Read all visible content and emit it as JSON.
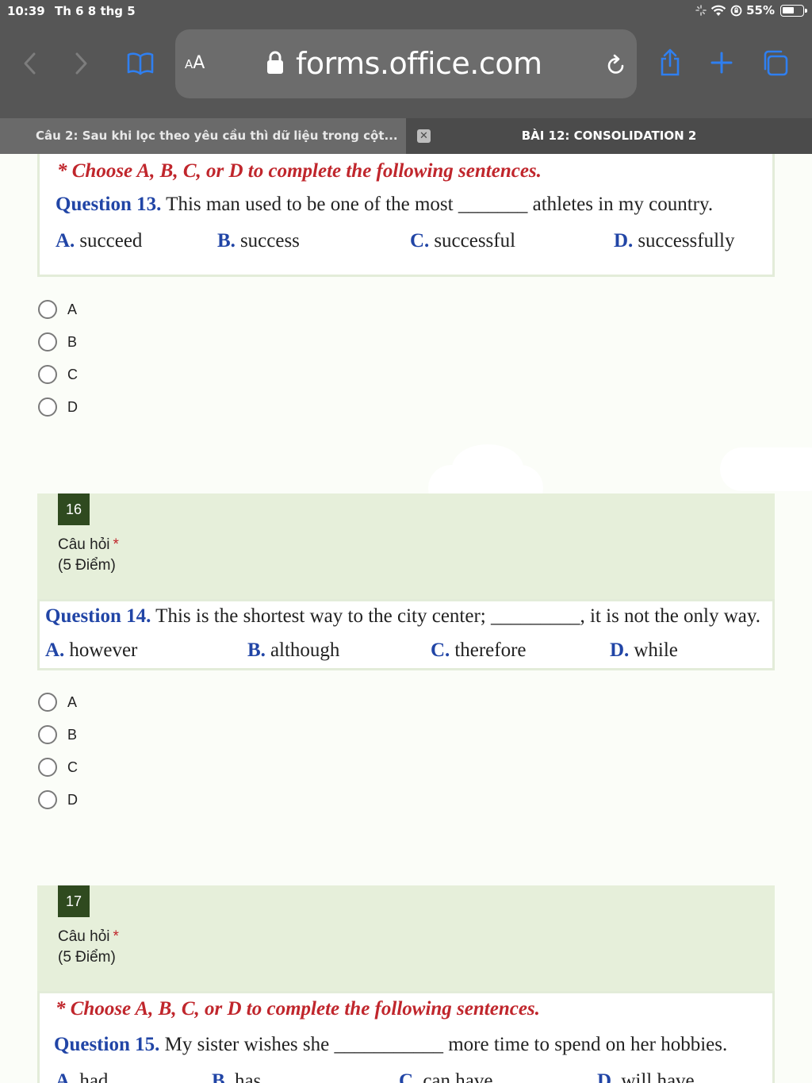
{
  "status_bar": {
    "time": "10:39",
    "date": "Th 6 8 thg 5",
    "battery": "55%"
  },
  "browser": {
    "url_aa": "AA",
    "domain": "forms.office.com",
    "tabs": [
      {
        "label": "Câu 2: Sau khi lọc theo yêu cầu thì dữ liệu trong cột...",
        "active": true
      },
      {
        "label": "BÀI 12: CONSOLIDATION 2",
        "active": false
      }
    ],
    "accent": "#2f7ff0"
  },
  "form": {
    "instruction": "* Choose A, B, C, or D to complete the following sentences.",
    "question_label": "Câu hỏi",
    "required_mark": "*",
    "q13": {
      "number_label": "Question 13.",
      "text": "This man used to be one of the most _______ athletes in my country.",
      "options": [
        {
          "letter": "A.",
          "text": "succeed"
        },
        {
          "letter": "B.",
          "text": "success"
        },
        {
          "letter": "C.",
          "text": "successful"
        },
        {
          "letter": "D.",
          "text": "successfully"
        }
      ],
      "choices": [
        "A",
        "B",
        "C",
        "D"
      ]
    },
    "q16": {
      "badge": "16",
      "points": "(5 Điểm)",
      "number_label": "Question 14.",
      "text": "This  is the shortest way to the city center; _________, it is not the only way.",
      "options": [
        {
          "letter": "A.",
          "text": "however"
        },
        {
          "letter": "B.",
          "text": "although"
        },
        {
          "letter": "C.",
          "text": "therefore"
        },
        {
          "letter": "D.",
          "text": "while"
        }
      ],
      "choices": [
        "A",
        "B",
        "C",
        "D"
      ]
    },
    "q17": {
      "badge": "17",
      "points": "(5 Điểm)",
      "number_label": "Question 15.",
      "text": "My sister wishes  she ___________ more time to spend on her hobbies.",
      "options": [
        {
          "letter": "A.",
          "text": "had"
        },
        {
          "letter": "B.",
          "text": "has"
        },
        {
          "letter": "C.",
          "text": "can have"
        },
        {
          "letter": "D.",
          "text": "will have"
        }
      ]
    }
  },
  "colors": {
    "card_green": "#e6efda",
    "badge_green": "#2f4a1f",
    "instruction_red": "#c0262c",
    "option_blue": "#2145a6"
  }
}
